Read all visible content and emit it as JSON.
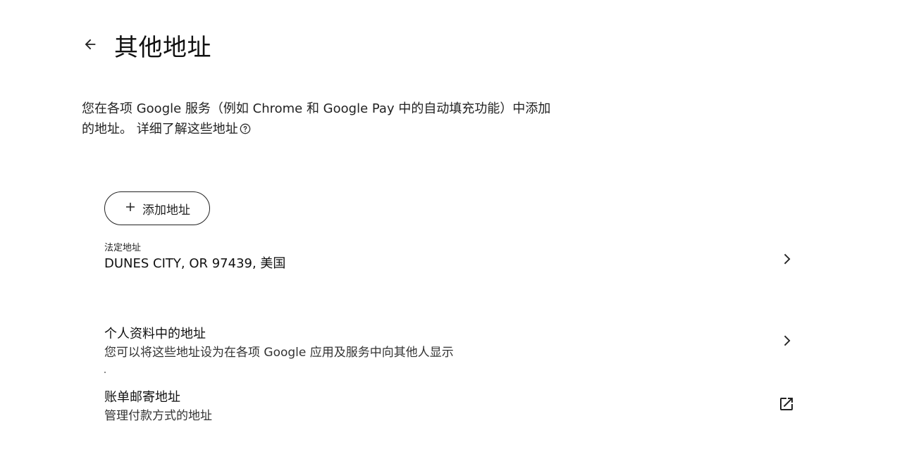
{
  "header": {
    "title": "其他地址",
    "back_icon": "arrow-back-icon"
  },
  "intro": {
    "text": "您在各项 Google 服务（例如 Chrome 和 Google Pay 中的自动填充功能）中添加的地址。",
    "learn_more": "详细了解这些地址",
    "help_icon": "help-circle-icon"
  },
  "add_button": {
    "label": "添加地址",
    "icon": "plus-icon"
  },
  "legal_address": {
    "label": "法定地址",
    "value": "DUNES CITY, OR 97439, 美国",
    "icon": "chevron-right-icon"
  },
  "profile_address": {
    "title": "个人资料中的地址",
    "subtitle": "您可以将这些地址设为在各项 Google 应用及服务中向其他人显示",
    "icon": "chevron-right-icon"
  },
  "billing_address": {
    "title": "账单邮寄地址",
    "subtitle": "管理付款方式的地址",
    "icon": "open-in-new-icon"
  }
}
